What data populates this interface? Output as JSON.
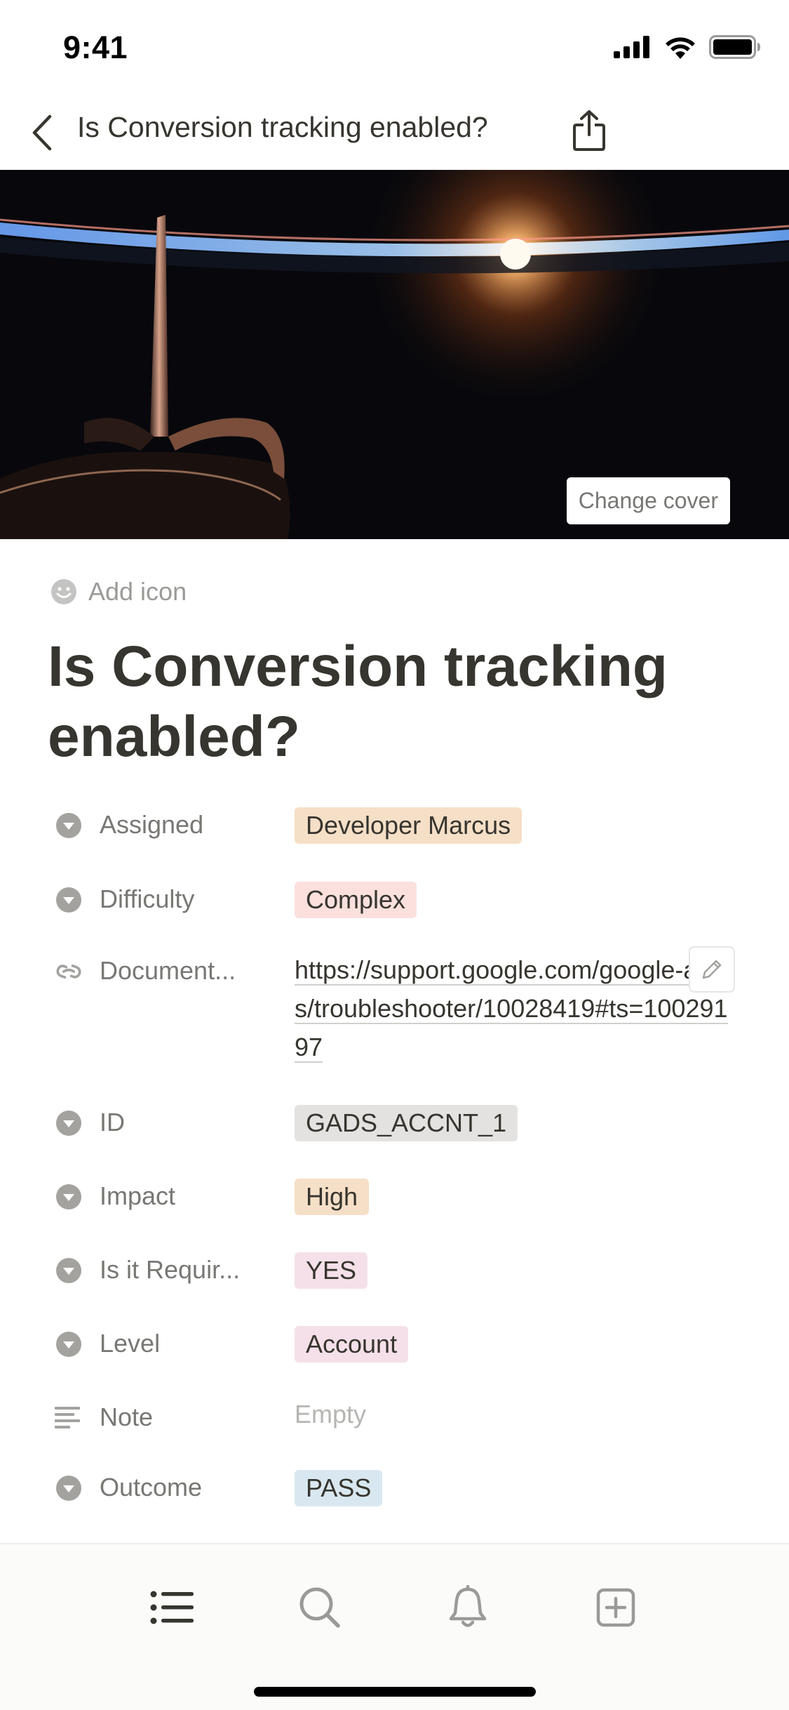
{
  "status_bar": {
    "time": "9:41"
  },
  "nav": {
    "title": "Is Conversion tracking enabled?"
  },
  "cover": {
    "change_cover_label": "Change cover"
  },
  "page": {
    "add_icon_label": "Add icon",
    "title": "Is Conversion tracking enabled?"
  },
  "properties": [
    {
      "name": "Assigned",
      "icon": "select-icon",
      "type": "tag",
      "value": "Developer Marcus",
      "color": "#f5dfc7"
    },
    {
      "name": "Difficulty",
      "icon": "select-icon",
      "type": "tag",
      "value": "Complex",
      "color": "#fbe0de"
    },
    {
      "name": "Document...",
      "icon": "url-icon",
      "type": "url",
      "value": "https://support.google.com/google-ads/troubleshooter/10028419#ts=10029197"
    },
    {
      "name": "ID",
      "icon": "select-icon",
      "type": "tag",
      "value": "GADS_ACCNT_1",
      "color": "#e3e2e0"
    },
    {
      "name": "Impact",
      "icon": "select-icon",
      "type": "tag",
      "value": "High",
      "color": "#f5dfc7"
    },
    {
      "name": "Is it Requir...",
      "icon": "select-icon",
      "type": "tag",
      "value": "YES",
      "color": "#f5e0e9"
    },
    {
      "name": "Level",
      "icon": "select-icon",
      "type": "tag",
      "value": "Account",
      "color": "#f5e0e9"
    },
    {
      "name": "Note",
      "icon": "text-icon",
      "type": "text",
      "value": "Empty"
    },
    {
      "name": "Outcome",
      "icon": "select-icon",
      "type": "tag",
      "value": "PASS",
      "color": "#d9e8f0"
    }
  ],
  "tab_bar": {
    "items": [
      {
        "name": "list-icon"
      },
      {
        "name": "search-icon"
      },
      {
        "name": "bell-icon"
      },
      {
        "name": "new-page-icon"
      }
    ]
  }
}
